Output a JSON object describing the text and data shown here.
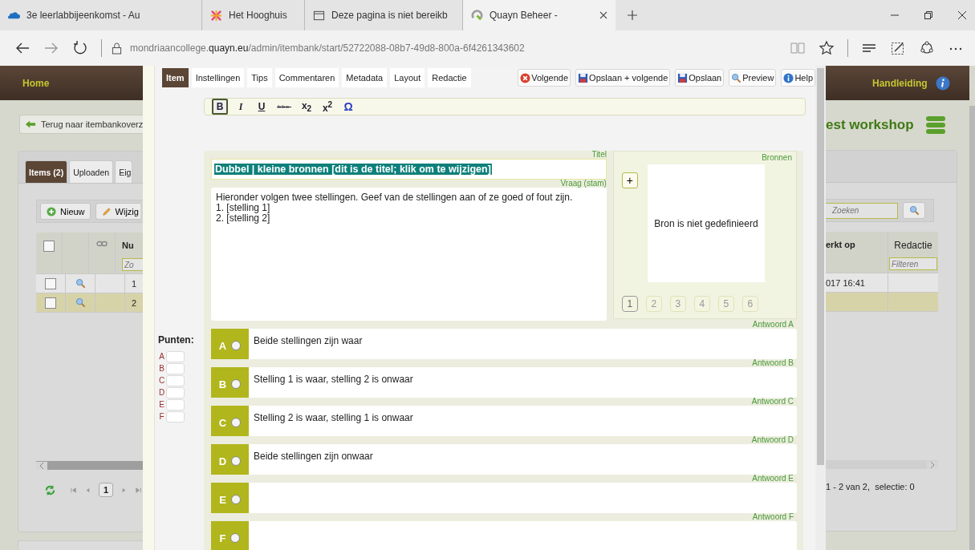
{
  "browser": {
    "tabs": [
      {
        "title": "3e leerlabbijeenkomst - Au",
        "kind": "cloud",
        "selected": false
      },
      {
        "title": "Het Hooghuis",
        "kind": "sparkle",
        "selected": false
      },
      {
        "title": "Deze pagina is niet bereikb",
        "kind": "page",
        "selected": false
      },
      {
        "title": "Quayn Beheer -",
        "kind": "logo",
        "selected": true
      }
    ],
    "address": {
      "subdomain": "mondriaancollege.",
      "domain": "quayn.eu",
      "path": "/admin/itembank/start/52722088-08b7-49d8-800a-6f4261343602"
    }
  },
  "app": {
    "header": {
      "home": "Home",
      "manual": "Handleiding"
    },
    "back_button": "Terug naar itembankoverz",
    "project_title": "est workshop",
    "panel_tabs": [
      {
        "label": "Items (2)",
        "selected": true
      },
      {
        "label": "Uploaden",
        "selected": false
      },
      {
        "label": "Eig",
        "selected": false
      }
    ],
    "toolbar": {
      "new": "Nieuw",
      "edit": "Wijzig",
      "search_placeholder": "Zoeken"
    },
    "table": {
      "header_checked": false,
      "columns": [
        "Nu",
        "erkt op",
        "Redactie"
      ],
      "filter_placeholders": [
        "Zo",
        "Filteren"
      ],
      "rows": [
        {
          "number": "1",
          "date": "017 16:41",
          "checked": false,
          "selected": false
        },
        {
          "number": "2",
          "checked": false,
          "selected": true
        }
      ]
    },
    "pager": {
      "page": "1",
      "summary": "1 - 2 van 2,  selectie: 0"
    }
  },
  "editor": {
    "tabs": [
      {
        "label": "Item",
        "selected": true
      },
      {
        "label": "Instellingen",
        "selected": false
      },
      {
        "label": "Tips",
        "selected": false
      },
      {
        "label": "Commentaren",
        "selected": false
      },
      {
        "label": "Metadata",
        "selected": false
      },
      {
        "label": "Layout",
        "selected": false
      },
      {
        "label": "Redactie",
        "selected": false
      }
    ],
    "actions": [
      {
        "label": "Volgende",
        "kind": "cancel"
      },
      {
        "label": "Opslaan + volgende",
        "kind": "save"
      },
      {
        "label": "Opslaan",
        "kind": "save"
      },
      {
        "label": "Preview",
        "kind": "preview"
      },
      {
        "label": "Help",
        "kind": "help"
      }
    ],
    "format_buttons": [
      {
        "label": "B",
        "kind": "bold",
        "selected": true
      },
      {
        "label": "I",
        "kind": "italic",
        "selected": false
      },
      {
        "label": "U",
        "kind": "underline",
        "selected": false
      },
      {
        "kind": "strike",
        "selected": false
      },
      {
        "label": "x$_{2}$",
        "kind": "plain",
        "selected": false
      },
      {
        "label": "x$^{2}$",
        "kind": "plain",
        "selected": false
      },
      {
        "label": "Ω",
        "kind": "symbol",
        "selected": false
      }
    ],
    "title": {
      "label": "Titel",
      "value": "Dubbel | kleine bronnen [dit is de titel; klik om te wijzigen]"
    },
    "question": {
      "label": "Vraag (stam)",
      "lines": [
        "Hieronder volgen twee stellingen. Geef van de stellingen aan of ze goed of fout zijn.",
        "1. [stelling 1]",
        "2. [stelling 2]"
      ]
    },
    "sources": {
      "label": "Bronnen",
      "add": "+",
      "empty": "Bron is niet gedefinieerd",
      "pages": [
        {
          "label": "1",
          "selected": true
        },
        {
          "label": "2",
          "selected": false
        },
        {
          "label": "3",
          "selected": false
        },
        {
          "label": "4",
          "selected": false
        },
        {
          "label": "5",
          "selected": false
        },
        {
          "label": "6",
          "selected": false
        }
      ]
    },
    "points": {
      "label": "Punten:",
      "letters": [
        "A",
        "B",
        "C",
        "D",
        "E",
        "F"
      ]
    },
    "answers": [
      {
        "letter": "A",
        "label": "Antwoord A",
        "text": "Beide stellingen zijn waar",
        "selected": false
      },
      {
        "letter": "B",
        "label": "Antwoord B",
        "text": "Stelling 1 is waar, stelling 2 is onwaar",
        "selected": false
      },
      {
        "letter": "C",
        "label": "Antwoord C",
        "text": "Stelling 2 is waar, stelling 1 is onwaar",
        "selected": false
      },
      {
        "letter": "D",
        "label": "Antwoord D",
        "text": "Beide stellingen zijn onwaar",
        "selected": false
      },
      {
        "letter": "E",
        "label": "Antwoord E",
        "selected": false
      },
      {
        "letter": "F",
        "label": "Antwoord F",
        "selected": false
      }
    ]
  }
}
